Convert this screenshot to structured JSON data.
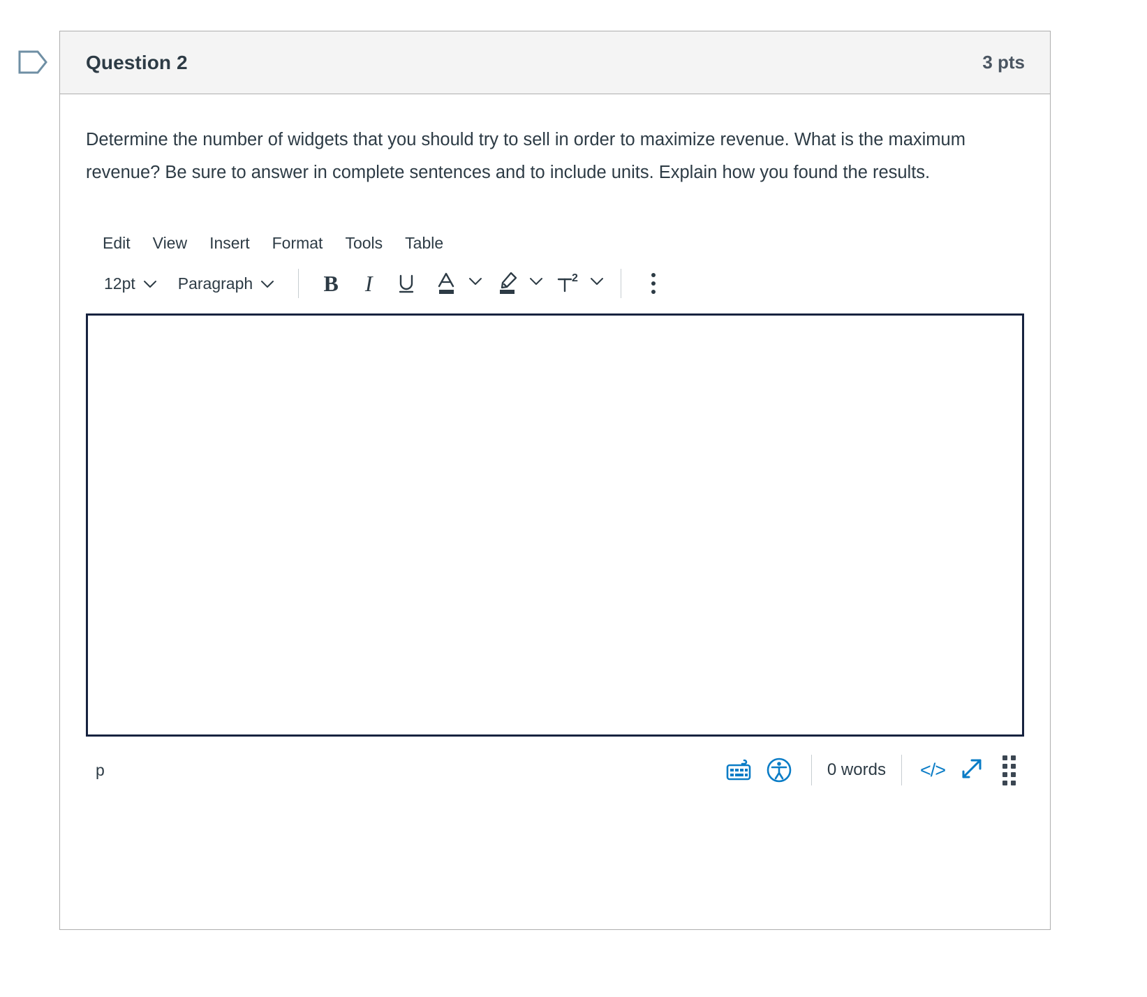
{
  "flag": {
    "icon": "flag-outline-icon"
  },
  "question": {
    "title": "Question 2",
    "points": "3 pts",
    "text": "Determine the number of widgets that you should try to sell in order to maximize revenue.  What is the maximum revenue?  Be sure to answer in complete sentences and to include units.  Explain how you found the results."
  },
  "editor": {
    "menubar": [
      {
        "label": "Edit"
      },
      {
        "label": "View"
      },
      {
        "label": "Insert"
      },
      {
        "label": "Format"
      },
      {
        "label": "Tools"
      },
      {
        "label": "Table"
      }
    ],
    "toolbar": {
      "font_size": "12pt",
      "block_format": "Paragraph",
      "bold": "B",
      "italic": "I",
      "underline_icon": "underline-icon",
      "text_color_icon": "text-color-icon",
      "highlight_icon": "highlight-color-icon",
      "superscript": "T²",
      "more_icon": "more-options-kebab-icon"
    },
    "content": "",
    "status": {
      "path": "p",
      "keyboard_icon": "keyboard-shortcuts-icon",
      "accessibility_icon": "accessibility-checker-icon",
      "word_count": "0 words",
      "html_editor": "</>",
      "fullscreen_icon": "fullscreen-expand-icon",
      "resize_icon": "resize-drag-handle-icon"
    }
  },
  "colors": {
    "header_bg": "#f4f4f4",
    "card_border": "#aeaeae",
    "text": "#2d3b45",
    "editor_focus_border": "#17233f",
    "link_blue": "#0a7cc6",
    "flag_outline": "#6f8fa4"
  }
}
